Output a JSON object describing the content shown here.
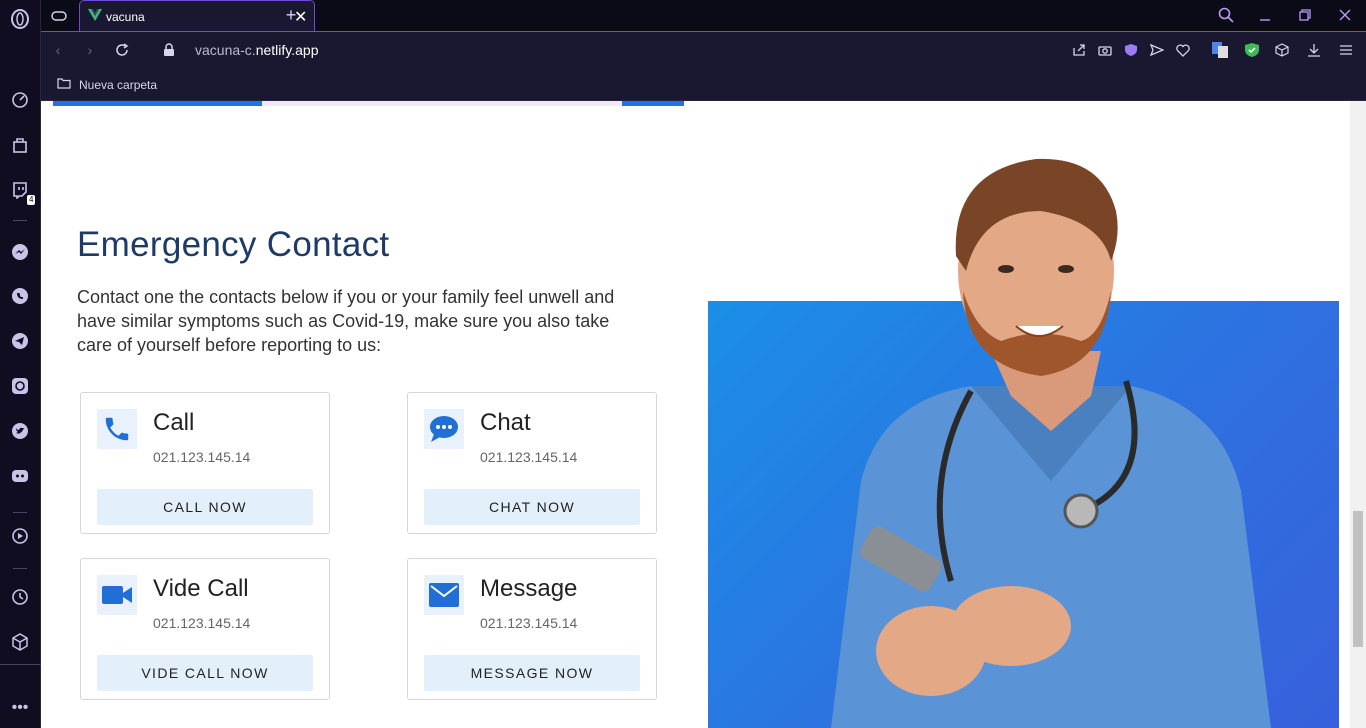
{
  "browser": {
    "tab_title": "vacuna",
    "address_url_prefix": "vacuna-c.",
    "address_url_domain": "netlify.app",
    "bookmark_label": "Nueva carpeta",
    "sidebar_badge": "4"
  },
  "colors": {
    "accent": "#1e73e8",
    "title": "#1e3a68",
    "card_button": "#e3effb",
    "hero_blue": "#2f6fe0"
  },
  "main": {
    "title": "Emergency Contact",
    "description": "Contact one the contacts below if you or your family feel unwell and have similar symptoms such as Covid-19, make sure you also take care of yourself before reporting to us:",
    "contacts": [
      {
        "title": "Call",
        "number": "021.123.145.14",
        "button": "CALL NOW",
        "icon": "phone-icon"
      },
      {
        "title": "Chat",
        "number": "021.123.145.14",
        "button": "CHAT NOW",
        "icon": "chat-icon"
      },
      {
        "title": "Vide Call",
        "number": "021.123.145.14",
        "button": "VIDE CALL NOW",
        "icon": "video-camera-icon"
      },
      {
        "title": "Message",
        "number": "021.123.145.14",
        "button": "MESSAGE NOW",
        "icon": "envelope-icon"
      }
    ]
  }
}
